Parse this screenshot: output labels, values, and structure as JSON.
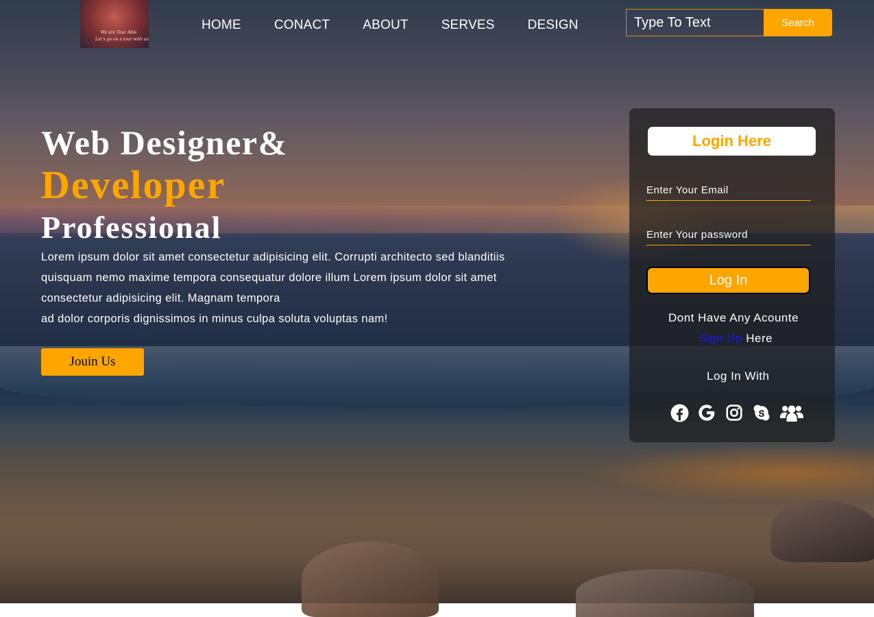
{
  "logo": {
    "line1": "We are Tour Able",
    "line2": "Let's go on a tour with us"
  },
  "nav": [
    {
      "label": "HOME"
    },
    {
      "label": "CONACT"
    },
    {
      "label": "ABOUT"
    },
    {
      "label": "SERVES"
    },
    {
      "label": "DESIGN"
    }
  ],
  "search": {
    "placeholder": "Type To Text",
    "button": "Search"
  },
  "hero": {
    "line1": "Web Designer&",
    "line2": "Developer",
    "line3": "Professional",
    "description": "Lorem ipsum dolor sit amet consectetur adipisicing elit. Corrupti architecto sed blanditiis quisquam nemo maxime tempora consequatur dolore illum Lorem ipsum dolor sit amet consectetur adipisicing elit. Magnam tempora",
    "description2": "ad dolor corporis dignissimos in minus culpa soluta voluptas nam!",
    "button": "Jouin Us"
  },
  "login": {
    "title": "Login Here",
    "email_placeholder": "Enter Your Email",
    "password_placeholder": "Enter Your password",
    "button": "Log In",
    "no_account": "Dont Have Any Acounte",
    "signup_link": "Sign Up",
    "signup_suffix": " Here",
    "login_with": "Log In With",
    "social_icons": [
      "facebook-icon",
      "google-icon",
      "instagram-icon",
      "skype-icon",
      "users-icon"
    ]
  },
  "colors": {
    "accent": "#ffa500",
    "link": "#1a1adf"
  }
}
